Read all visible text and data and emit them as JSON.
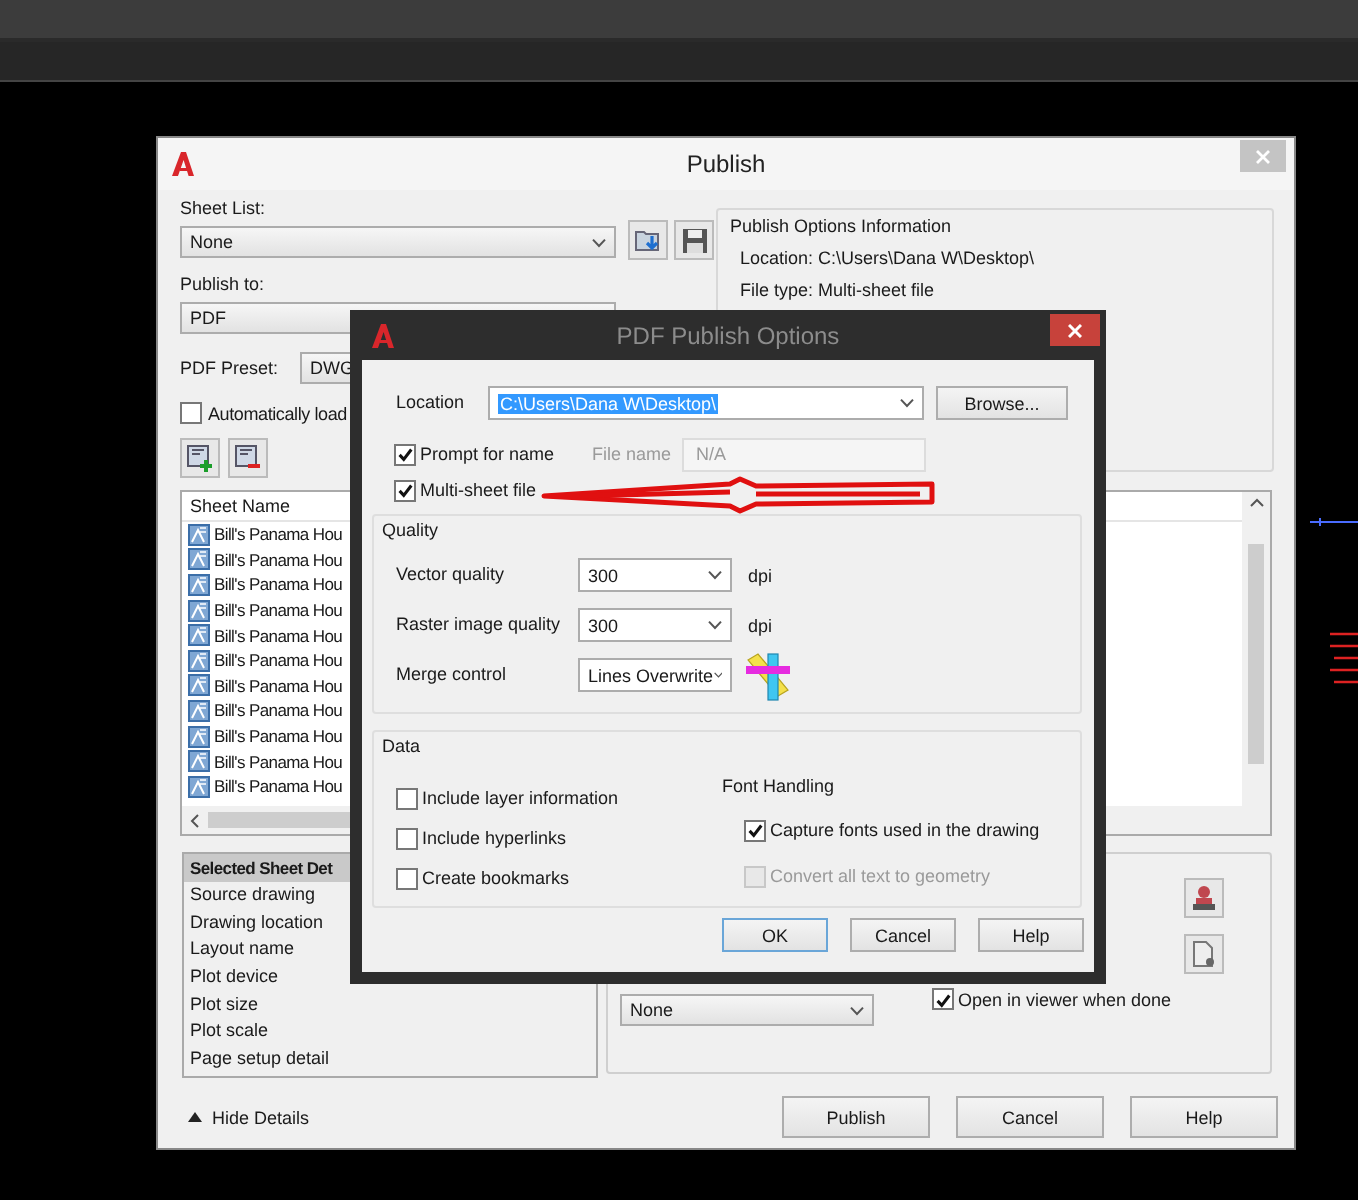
{
  "publish_dialog": {
    "title": "Publish",
    "sheet_list": {
      "label": "Sheet List:",
      "value": "None"
    },
    "publish_to": {
      "label": "Publish to:",
      "value": "PDF"
    },
    "pdf_preset": {
      "label": "PDF Preset:",
      "value": "DWG"
    },
    "auto_load": {
      "label": "Automatically load",
      "checked": false
    },
    "sheets": {
      "column": "Sheet Name",
      "rows": [
        {
          "name": "Bill's Panama Hou"
        },
        {
          "name": "Bill's Panama Hou"
        },
        {
          "name": "Bill's Panama Hou"
        },
        {
          "name": "Bill's Panama Hou"
        },
        {
          "name": "Bill's Panama Hou"
        },
        {
          "name": "Bill's Panama Hou"
        },
        {
          "name": "Bill's Panama Hou"
        },
        {
          "name": "Bill's Panama Hou"
        },
        {
          "name": "Bill's Panama Hou"
        },
        {
          "name": "Bill's Panama Hou"
        },
        {
          "name": "Bill's Panama Hou"
        }
      ]
    },
    "options_info": {
      "title": "Publish Options Information",
      "lines": [
        "Location: C:\\Users\\Dana W\\Desktop\\",
        "File type: Multi-sheet file"
      ]
    },
    "details": {
      "header": "Selected Sheet Det",
      "items": [
        "Source drawing",
        "Drawing location",
        "Layout name",
        "Plot device",
        "Plot size",
        "Plot scale",
        "Page setup detail"
      ]
    },
    "stamp_dropdown": {
      "value": "None"
    },
    "open_in_viewer": {
      "label": "Open in viewer when done",
      "checked": true
    },
    "hide_details": "Hide Details",
    "buttons": [
      "Publish",
      "Cancel",
      "Help"
    ]
  },
  "options_dialog": {
    "title": "PDF Publish Options",
    "location": {
      "label": "Location",
      "value": "C:\\Users\\Dana W\\Desktop\\",
      "text_selected": true
    },
    "browse": "Browse...",
    "prompt_for_name": {
      "label": "Prompt for name",
      "checked": true
    },
    "file_name": {
      "label": "File name",
      "value": "N/A",
      "disabled": true
    },
    "multi_sheet": {
      "label": "Multi-sheet file",
      "checked": true
    },
    "quality": {
      "title": "Quality",
      "rows": [
        {
          "label": "Vector quality",
          "value": "300",
          "unit": "dpi"
        },
        {
          "label": "Raster image quality",
          "value": "300",
          "unit": "dpi"
        },
        {
          "label": "Merge control",
          "value": "Lines Overwrite"
        }
      ]
    },
    "data": {
      "title": "Data",
      "options": [
        {
          "label": "Include layer information",
          "checked": false
        },
        {
          "label": "Include hyperlinks",
          "checked": false
        },
        {
          "label": "Create bookmarks",
          "checked": false
        }
      ]
    },
    "font_handling": {
      "title": "Font Handling",
      "options": [
        {
          "label": "Capture fonts used in the drawing",
          "checked": true,
          "disabled": false
        },
        {
          "label": "Convert all text to geometry",
          "checked": false,
          "disabled": true
        }
      ]
    },
    "buttons": [
      "OK",
      "Cancel",
      "Help"
    ]
  }
}
